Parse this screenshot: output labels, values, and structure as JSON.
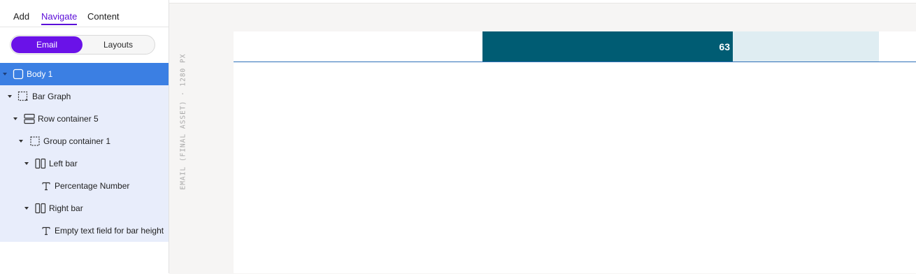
{
  "sidebar": {
    "tabs": [
      {
        "label": "Add",
        "active": false
      },
      {
        "label": "Navigate",
        "active": true
      },
      {
        "label": "Content",
        "active": false
      }
    ],
    "mode_toggle": {
      "email_label": "Email",
      "layouts_label": "Layouts",
      "selected": "Email"
    },
    "tree": [
      {
        "label": "Body 1",
        "icon": "body-icon",
        "depth": 0,
        "selected": true
      },
      {
        "label": "Bar Graph",
        "icon": "group-icon",
        "depth": 1
      },
      {
        "label": "Row container 5",
        "icon": "row-container-icon",
        "depth": 2
      },
      {
        "label": "Group container 1",
        "icon": "group-icon",
        "depth": 3
      },
      {
        "label": "Left bar",
        "icon": "columns-icon",
        "depth": 4
      },
      {
        "label": "Percentage Number",
        "icon": "text-icon",
        "depth": 5
      },
      {
        "label": "Right bar",
        "icon": "columns-icon",
        "depth": 4
      },
      {
        "label": "Empty text field for bar height",
        "icon": "text-icon",
        "depth": 5
      }
    ]
  },
  "canvas": {
    "frame_label": "EMAIL (FINAL ASSET) · 1280 PX",
    "bar_graph": {
      "percentage": "63",
      "left_color": "#005c73",
      "right_color": "#dfedf2"
    }
  },
  "colors": {
    "accent": "#6a12e8",
    "selection": "#3b7fe3",
    "tree_bg": "#e8edfb"
  }
}
